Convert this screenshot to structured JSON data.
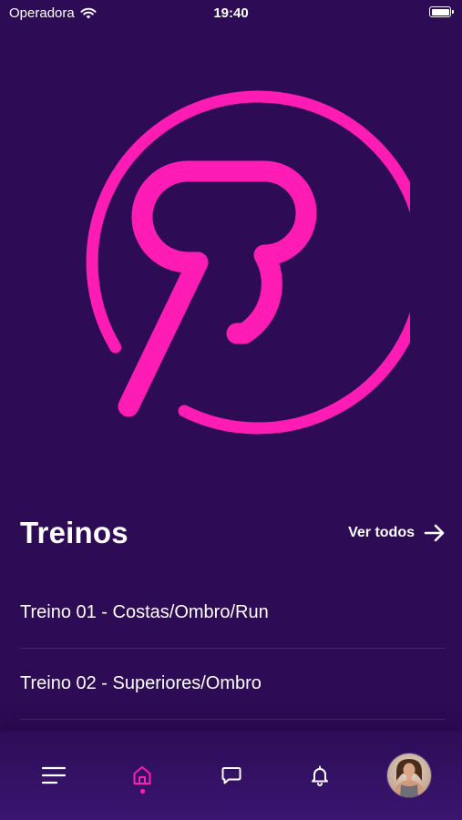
{
  "status_bar": {
    "carrier": "Operadora",
    "time": "19:40"
  },
  "colors": {
    "background": "#2d0b55",
    "accent": "#ff1cb4",
    "divider": "#4b1d86"
  },
  "logo": {
    "icon": "brand-logo"
  },
  "treinos": {
    "title": "Treinos",
    "see_all_label": "Ver todos",
    "items": [
      {
        "label": "Treino 01 - Costas/Ombro/Run"
      },
      {
        "label": "Treino 02 - Superiores/Ombro"
      }
    ]
  },
  "tab_bar": {
    "tabs": [
      {
        "icon": "menu-icon",
        "active": false
      },
      {
        "icon": "home-icon",
        "active": true
      },
      {
        "icon": "chat-icon",
        "active": false
      },
      {
        "icon": "bell-icon",
        "active": false
      },
      {
        "icon": "avatar",
        "active": false
      }
    ]
  }
}
